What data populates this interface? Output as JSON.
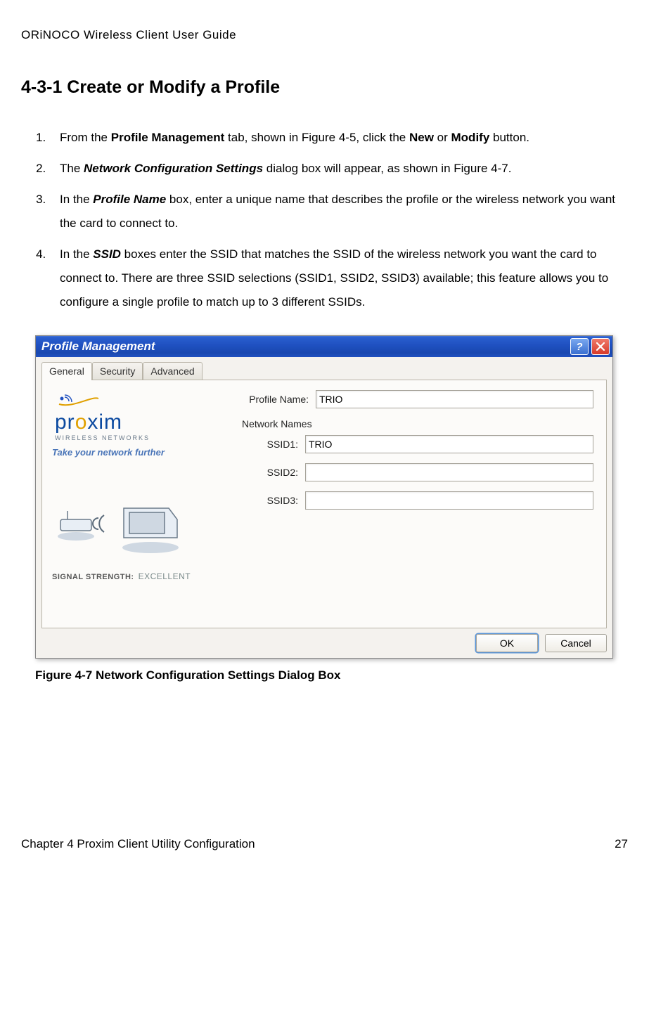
{
  "doc_header": "ORiNOCO Wireless Client User Guide",
  "section_heading": "4-3-1 Create or Modify a Profile",
  "steps": {
    "s1": {
      "pre": "From the ",
      "b1": "Profile Management",
      "mid": " tab, shown in Figure 4-5, click the ",
      "b2": "New",
      "or": " or ",
      "b3": "Modify",
      "post": " button."
    },
    "s2": {
      "pre": "The ",
      "bi": "Network Configuration Settings",
      "post": " dialog box will appear, as shown in Figure 4-7."
    },
    "s3": {
      "pre": "In the ",
      "bi": "Profile Name",
      "post": " box, enter a unique name that describes the profile or the wireless network you want the card to connect to."
    },
    "s4": {
      "pre": "In the ",
      "bi": "SSID",
      "post": " boxes enter the SSID that matches the SSID of the wireless network you want the card to connect to. There are three SSID selections (SSID1, SSID2, SSID3) available; this feature allows you to configure a single profile to match up to 3 different SSIDs."
    }
  },
  "dialog": {
    "title": "Profile Management",
    "tabs": {
      "general": "General",
      "security": "Security",
      "advanced": "Advanced"
    },
    "brand": {
      "name_pre": "pr",
      "name_dot": "o",
      "name_post": "xim",
      "sub": "WIRELESS NETWORKS",
      "tagline": "Take your network further"
    },
    "signal": {
      "label": "SIGNAL STRENGTH:",
      "value": "EXCELLENT"
    },
    "labels": {
      "profile_name": "Profile Name:",
      "network_names": "Network Names",
      "ssid1": "SSID1:",
      "ssid2": "SSID2:",
      "ssid3": "SSID3:"
    },
    "values": {
      "profile_name": "TRIO",
      "ssid1": "TRIO",
      "ssid2": "",
      "ssid3": ""
    },
    "buttons": {
      "ok": "OK",
      "cancel": "Cancel",
      "help_glyph": "?"
    }
  },
  "figure_caption": "Figure 4-7  Network Configuration Settings Dialog Box",
  "footer": {
    "left": "Chapter 4 Proxim Client Utility Configuration",
    "right": "27"
  }
}
